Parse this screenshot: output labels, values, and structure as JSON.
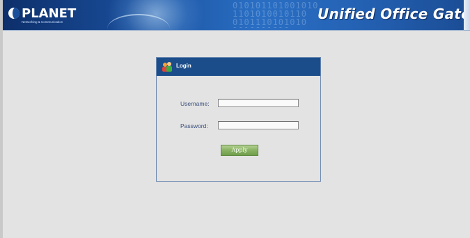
{
  "header": {
    "logo_text": "PLANET",
    "logo_subtext": "Networking & Communication",
    "app_title": "Unified Office Gateway",
    "background_digits": "010101101001010 1101010010110 0101110101010 1010011010"
  },
  "login": {
    "title": "Login",
    "username_label": "Username:",
    "username_value": "",
    "password_label": "Password:",
    "password_value": "",
    "apply_label": "Apply"
  },
  "colors": {
    "header_blue": "#1a4f9c",
    "panel_header": "#1b4d8a",
    "content_bg": "#e3e3e3",
    "button_green": "#8bb464",
    "label_text": "#3a4f7a"
  }
}
